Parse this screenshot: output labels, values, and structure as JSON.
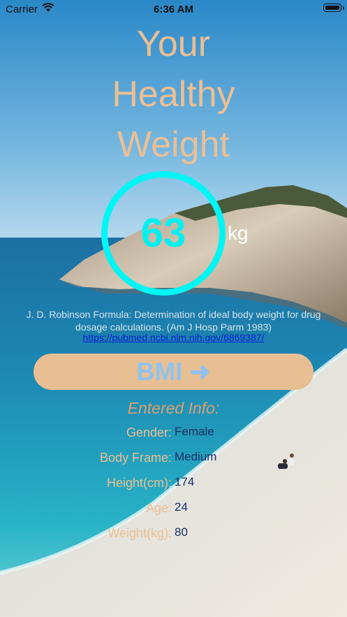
{
  "status_bar": {
    "carrier": "Carrier",
    "time": "6:36 AM"
  },
  "title": {
    "line1": "Your",
    "line2": "Healthy",
    "line3": "Weight"
  },
  "result": {
    "weight": "63",
    "unit": "kg"
  },
  "formula": {
    "text": "J. D. Robinson Formula: Determination of ideal body weight for drug dosage calculations. (Am J Hosp Parm 1983)",
    "link": "https://pubmed.ncbi.nlm.nih.gov/6869387/"
  },
  "bmi_button": {
    "label": "BMI ➜"
  },
  "info": {
    "title": "Entered Info:",
    "rows": [
      {
        "label": "Gender:",
        "value": "Female"
      },
      {
        "label": "Body Frame:",
        "value": "Medium"
      },
      {
        "label": "Height(cm):",
        "value": "174"
      },
      {
        "label": "Age:",
        "value": "24"
      },
      {
        "label": "Weight(kg):",
        "value": "80"
      }
    ]
  },
  "colors": {
    "title": "#ecbf93",
    "ring": "#00f5f5",
    "button": "#e8bf92",
    "button_text": "#8fc2ef",
    "info_value": "#1b2e66"
  },
  "icons": [
    "wifi-icon",
    "battery-icon"
  ]
}
